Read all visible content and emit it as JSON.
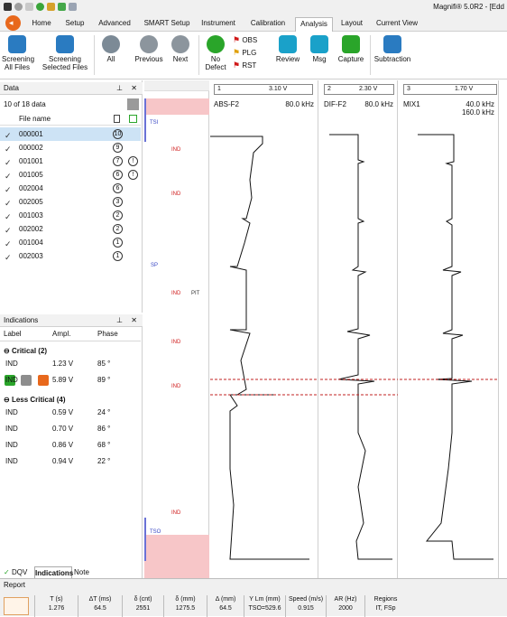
{
  "titlebar": {
    "title": "Magnifi® 5.0R2 - [Edd"
  },
  "tabs": [
    "Home",
    "Setup",
    "Advanced",
    "SMART Setup",
    "Instrument",
    "Calibration",
    "Analysis",
    "Layout",
    "Current View"
  ],
  "ribbon": {
    "screening_all": "Screening All Files",
    "screening_selected": "Screening Selected Files",
    "all": "All",
    "previous": "Previous",
    "next": "Next",
    "no_defect": "No Defect",
    "obs": "OBS",
    "plg": "PLG",
    "rst": "RST",
    "review": "Review",
    "msg": "Msg",
    "capture": "Capture",
    "subtraction": "Subtraction"
  },
  "data_panel": {
    "title": "Data",
    "count": "10 of 18 data",
    "col_file": "File name",
    "rows": [
      {
        "name": "000001",
        "count": "10",
        "selected": true,
        "warn": ""
      },
      {
        "name": "000002",
        "count": "9",
        "selected": false,
        "warn": ""
      },
      {
        "name": "001001",
        "count": "7",
        "selected": false,
        "warn": "!"
      },
      {
        "name": "001005",
        "count": "6",
        "selected": false,
        "warn": "!"
      },
      {
        "name": "002004",
        "count": "6",
        "selected": false,
        "warn": ""
      },
      {
        "name": "002005",
        "count": "3",
        "selected": false,
        "warn": ""
      },
      {
        "name": "001003",
        "count": "2",
        "selected": false,
        "warn": ""
      },
      {
        "name": "002002",
        "count": "2",
        "selected": false,
        "warn": ""
      },
      {
        "name": "001004",
        "count": "1",
        "selected": false,
        "warn": ""
      },
      {
        "name": "002003",
        "count": "1",
        "selected": false,
        "warn": ""
      }
    ]
  },
  "indications": {
    "title": "Indications",
    "cols": [
      "Label",
      "Ampl.",
      "Phase"
    ],
    "critical": "Critical (2)",
    "less_critical": "Less Critical (4)",
    "crit_rows": [
      {
        "label": "IND",
        "ampl": "1.23 V",
        "phase": "85 °"
      },
      {
        "label": "IND",
        "ampl": "5.89 V",
        "phase": "89 °"
      }
    ],
    "less_rows": [
      {
        "label": "IND",
        "ampl": "0.59 V",
        "phase": "24 °"
      },
      {
        "label": "IND",
        "ampl": "0.70 V",
        "phase": "86 °"
      },
      {
        "label": "IND",
        "ampl": "0.86 V",
        "phase": "68 °"
      },
      {
        "label": "IND",
        "ampl": "0.94 V",
        "phase": "22 °"
      }
    ]
  },
  "bottom_tabs": {
    "dqv": "DQV",
    "indications": "Indications",
    "note": "Note"
  },
  "strip": {
    "labels": {
      "tsi": "TSI",
      "sp": "SP",
      "tso": "TSO",
      "pit": "PIT",
      "ind": "IND"
    }
  },
  "charts": [
    {
      "id": "1",
      "volt": "3.10 V",
      "name": "ABS-F2",
      "freq": "80.0 kHz",
      "freq2": ""
    },
    {
      "id": "2",
      "volt": "2.30 V",
      "name": "DIF-F2",
      "freq": "80.0 kHz",
      "freq2": ""
    },
    {
      "id": "3",
      "volt": "1.70 V",
      "name": "MIX1",
      "freq": "40.0 kHz",
      "freq2": "160.0 kHz"
    }
  ],
  "report": {
    "title": "Report",
    "cells": [
      {
        "h": "T (s)",
        "v": "1.276"
      },
      {
        "h": "ΔT (ms)",
        "v": "64.5"
      },
      {
        "h": "δ (cnt)",
        "v": "2551"
      },
      {
        "h": "δ (mm)",
        "v": "1275.5"
      },
      {
        "h": "Δ (mm)",
        "v": "64.5"
      },
      {
        "h": "Y Lm (mm)",
        "v": "TSO=529.6"
      },
      {
        "h": "Speed (m/s)",
        "v": "0.915"
      },
      {
        "h": "AR (Hz)",
        "v": "2000"
      },
      {
        "h": "Regions",
        "v": "IT, FSp"
      }
    ]
  },
  "colors": {
    "accent": "#e8681c",
    "selection": "#cde3f5",
    "pink": "#f7c6c8",
    "green": "#2aa52a"
  }
}
